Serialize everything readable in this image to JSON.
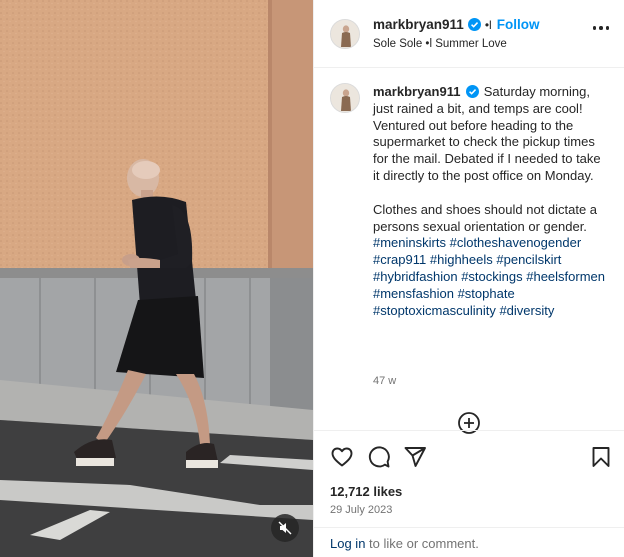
{
  "post": {
    "username": "markbryan911",
    "header_separator": "•l",
    "follow_label": "Follow",
    "audio": "Sole Sole •l Summer Love"
  },
  "caption": {
    "username": "markbryan911",
    "paragraph1": "Saturday morning, just rained a bit, and temps are cool! Ventured out before heading to the supermarket to check the pickup times for the mail. Debated if I needed to take it directly to the post office on Monday.",
    "paragraph2": "Clothes and shoes should not dictate a persons sexual orientation or gender.",
    "hashtags": [
      "#meninskirts",
      "#clotheshavenogender",
      "#crap911",
      "#highheels",
      "#pencilskirt",
      "#hybridfashion",
      "#stockings",
      "#heelsformen",
      "#mensfashion",
      "#stophate",
      "#stoptoxicmasculinity",
      "#diversity"
    ],
    "time_ago": "47 w"
  },
  "stats": {
    "likes": "12,712 likes",
    "date": "29 July 2023"
  },
  "login": {
    "link": "Log in",
    "rest": " to like or comment."
  },
  "icons": {
    "verified": "verified-badge-icon",
    "more": "more-options-icon",
    "load_more": "plus-circle-icon",
    "like": "heart-icon",
    "comment": "comment-icon",
    "share": "share-icon",
    "save": "bookmark-icon",
    "mute": "muted-speaker-icon"
  },
  "colors": {
    "accent": "#0095f6",
    "link": "#00376b",
    "muted_text": "#737373",
    "divider": "#efefef"
  }
}
